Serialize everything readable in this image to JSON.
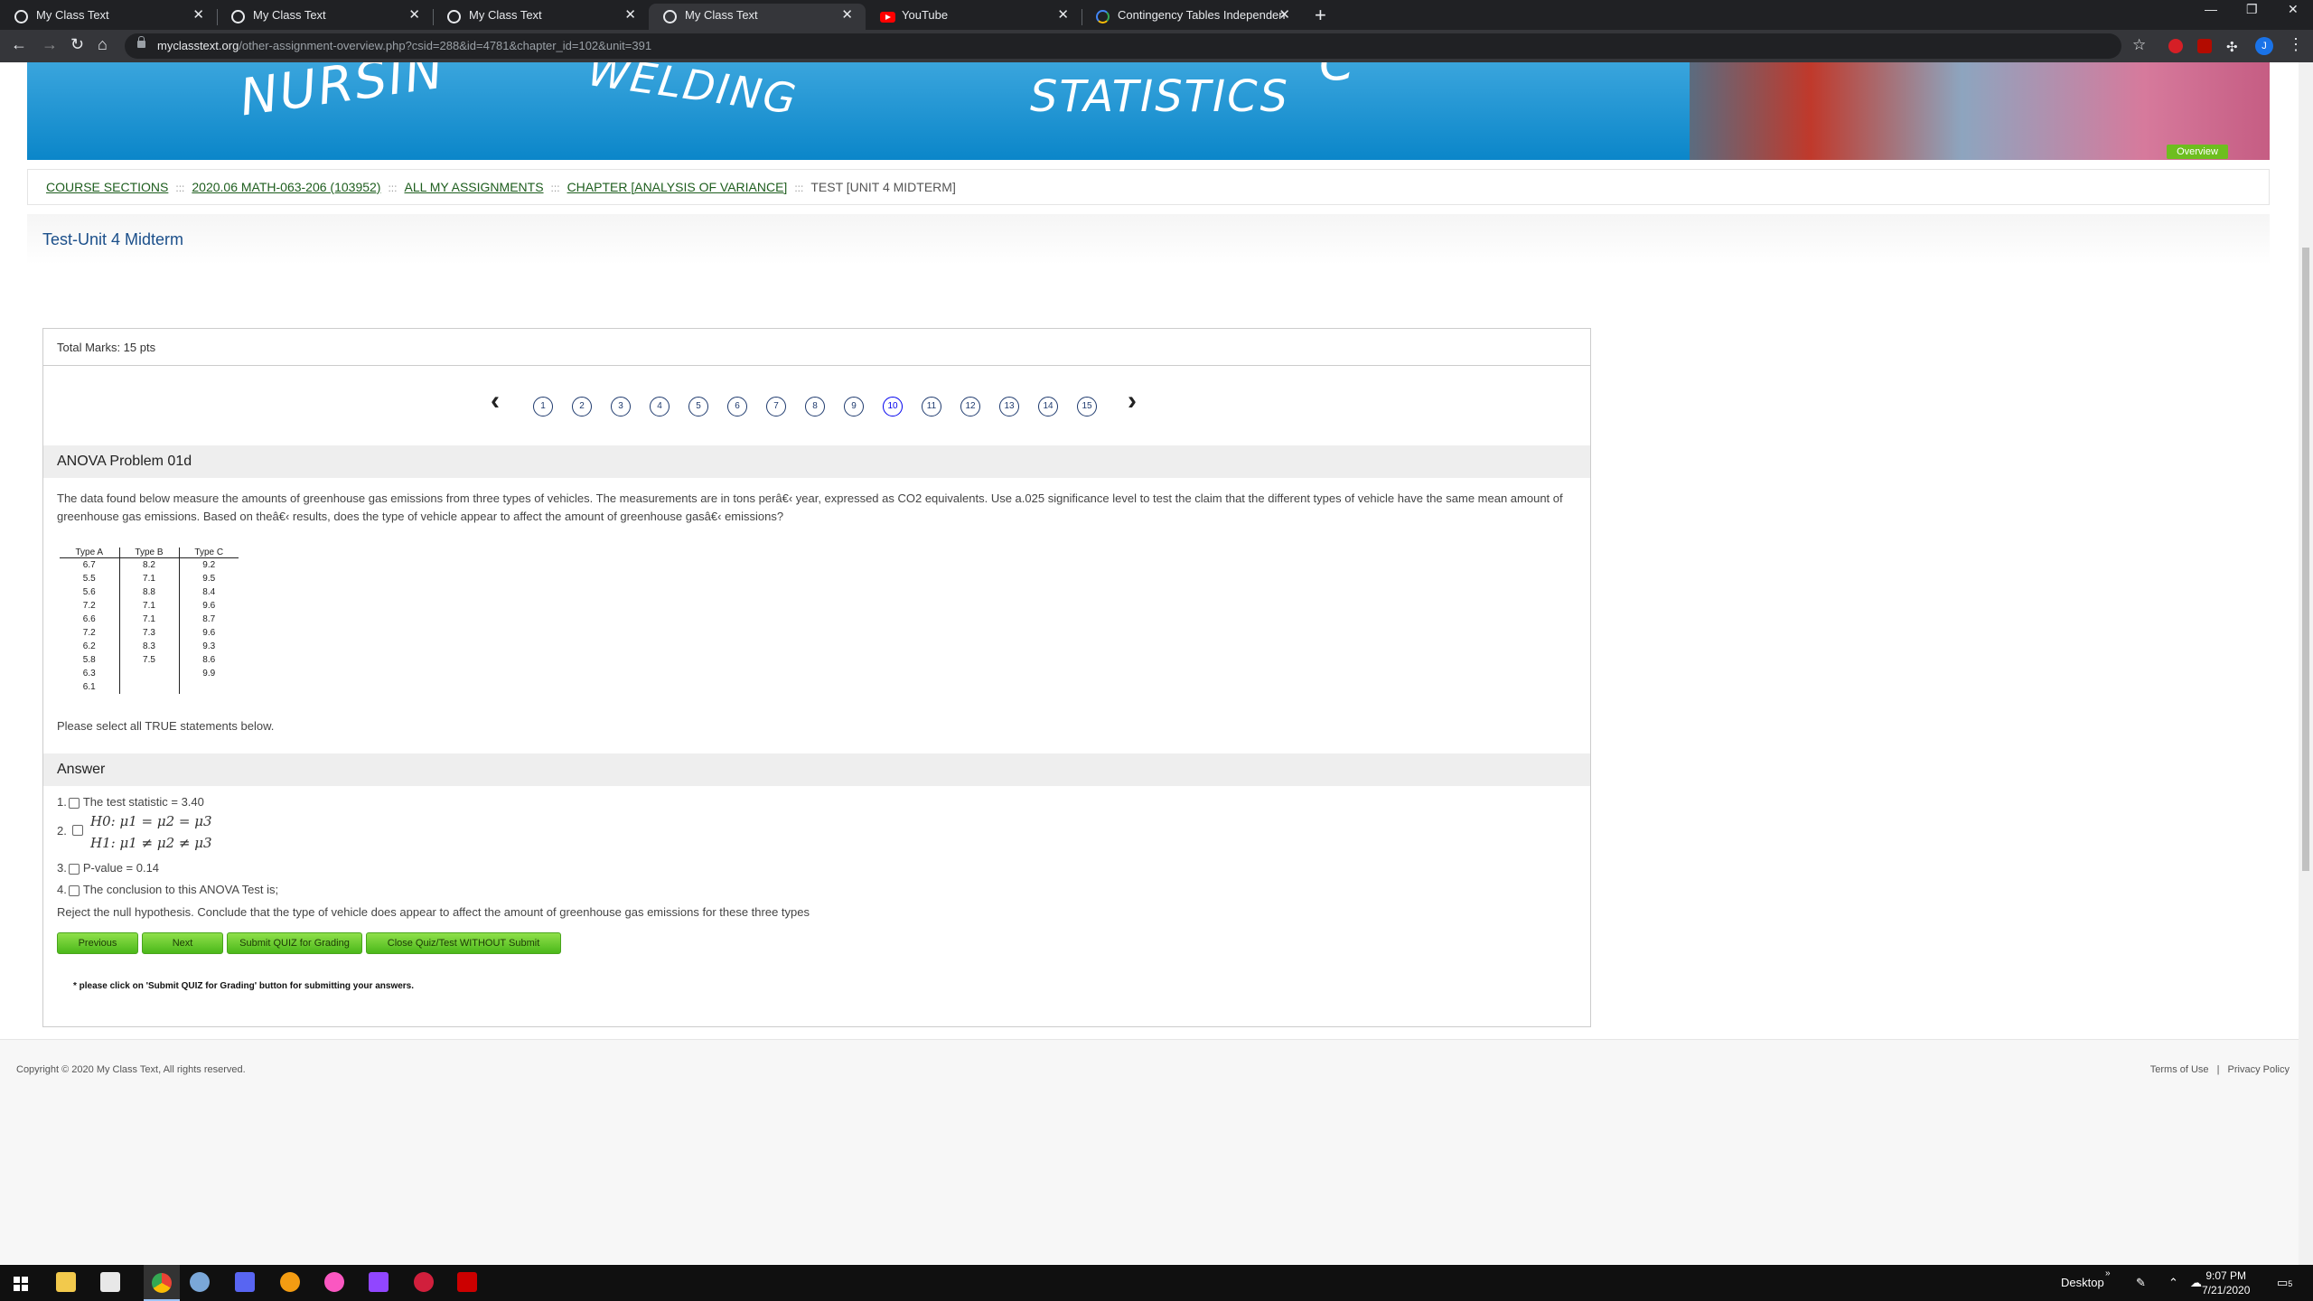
{
  "browser": {
    "tabs": [
      {
        "title": "My Class Text",
        "icon": "page-icon",
        "active": false
      },
      {
        "title": "My Class Text",
        "icon": "page-icon",
        "active": false
      },
      {
        "title": "My Class Text",
        "icon": "page-icon",
        "active": false
      },
      {
        "title": "My Class Text",
        "icon": "page-icon",
        "active": true
      },
      {
        "title": "YouTube",
        "icon": "youtube-icon",
        "active": false
      },
      {
        "title": "Contingency Tables Independen",
        "icon": "google-icon",
        "active": false
      }
    ],
    "url_domain": "myclasstext.org",
    "url_path": "/other-assignment-overview.php?csid=288&id=4781&chapter_id=102&unit=391",
    "profile_initial": "J"
  },
  "banner": {
    "words": [
      "NURSIN",
      "WELDING",
      "STATISTICS",
      "C"
    ]
  },
  "breadcrumb": {
    "items": [
      "COURSE SECTIONS",
      "2020.06 MATH-063-206 (103952)",
      "ALL MY ASSIGNMENTS",
      "CHAPTER [ANALYSIS OF VARIANCE]"
    ],
    "current": "TEST [UNIT 4 MIDTERM]",
    "separator": ":::"
  },
  "page": {
    "title": "Test-Unit 4 Midterm",
    "overview_label": "Overview",
    "total_marks": "Total Marks: 15 pts"
  },
  "question_nav": {
    "prev_arrow": "‹",
    "next_arrow": "›",
    "numbers": [
      "1",
      "2",
      "3",
      "4",
      "5",
      "6",
      "7",
      "8",
      "9",
      "10",
      "11",
      "12",
      "13",
      "14",
      "15"
    ],
    "current": "10"
  },
  "question": {
    "heading": "ANOVA Problem 01d",
    "text": "The data found below measure the amounts of greenhouse gas emissions from three types of vehicles. The measurements are in tons perâ€‹ year, expressed as CO2 equivalents. Use a.025 significance level to test the claim that the different types of vehicle have the same mean amount of greenhouse gas emissions. Based on theâ€‹ results, does the type of vehicle appear to affect the amount of greenhouse gasâ€‹ emissions?",
    "table_headers": [
      "Type A",
      "Type B",
      "Type C"
    ],
    "table_rows": [
      [
        "6.7",
        "8.2",
        "9.2"
      ],
      [
        "5.5",
        "7.1",
        "9.5"
      ],
      [
        "5.6",
        "8.8",
        "8.4"
      ],
      [
        "7.2",
        "7.1",
        "9.6"
      ],
      [
        "6.6",
        "7.1",
        "8.7"
      ],
      [
        "7.2",
        "7.3",
        "9.6"
      ],
      [
        "6.2",
        "8.3",
        "9.3"
      ],
      [
        "5.8",
        "7.5",
        "8.6"
      ],
      [
        "6.3",
        "",
        "9.9"
      ],
      [
        "6.1",
        "",
        ""
      ]
    ],
    "instruction": "Please select all TRUE statements below."
  },
  "answer": {
    "heading": "Answer",
    "options": [
      {
        "num": "1.",
        "text": "The test statistic = 3.40"
      },
      {
        "num": "2.",
        "line1": "H0: μ1 = μ2 = μ3",
        "line2": "H1: μ1 ≠ μ2 ≠ μ3"
      },
      {
        "num": "3.",
        "text": "P-value = 0.14"
      },
      {
        "num": "4.",
        "text": "The conclusion to this ANOVA Test is;"
      }
    ],
    "conclusion": "Reject the null hypothesis. Conclude that the type of vehicle does appear to affect the amount of greenhouse gas emissions for these three types"
  },
  "buttons": {
    "previous": "Previous",
    "next": "Next",
    "submit": "Submit QUIZ for Grading",
    "close": "Close Quiz/Test WITHOUT Submit"
  },
  "note": "* please click on 'Submit QUIZ for Grading' button for submitting your answers.",
  "footer": {
    "copyright": "Copyright © 2020 My Class Text, All rights reserved.",
    "terms": "Terms of Use",
    "privacy": "Privacy Policy",
    "separator": "|"
  },
  "taskbar": {
    "desktop_label": "Desktop",
    "time": "9:07 PM",
    "date": "7/21/2020",
    "notification_count": "5"
  },
  "colors": {
    "title_blue": "#1b4f8a",
    "breadcrumb_link": "#1e5e1e",
    "button_green": "#6dbe1f"
  }
}
